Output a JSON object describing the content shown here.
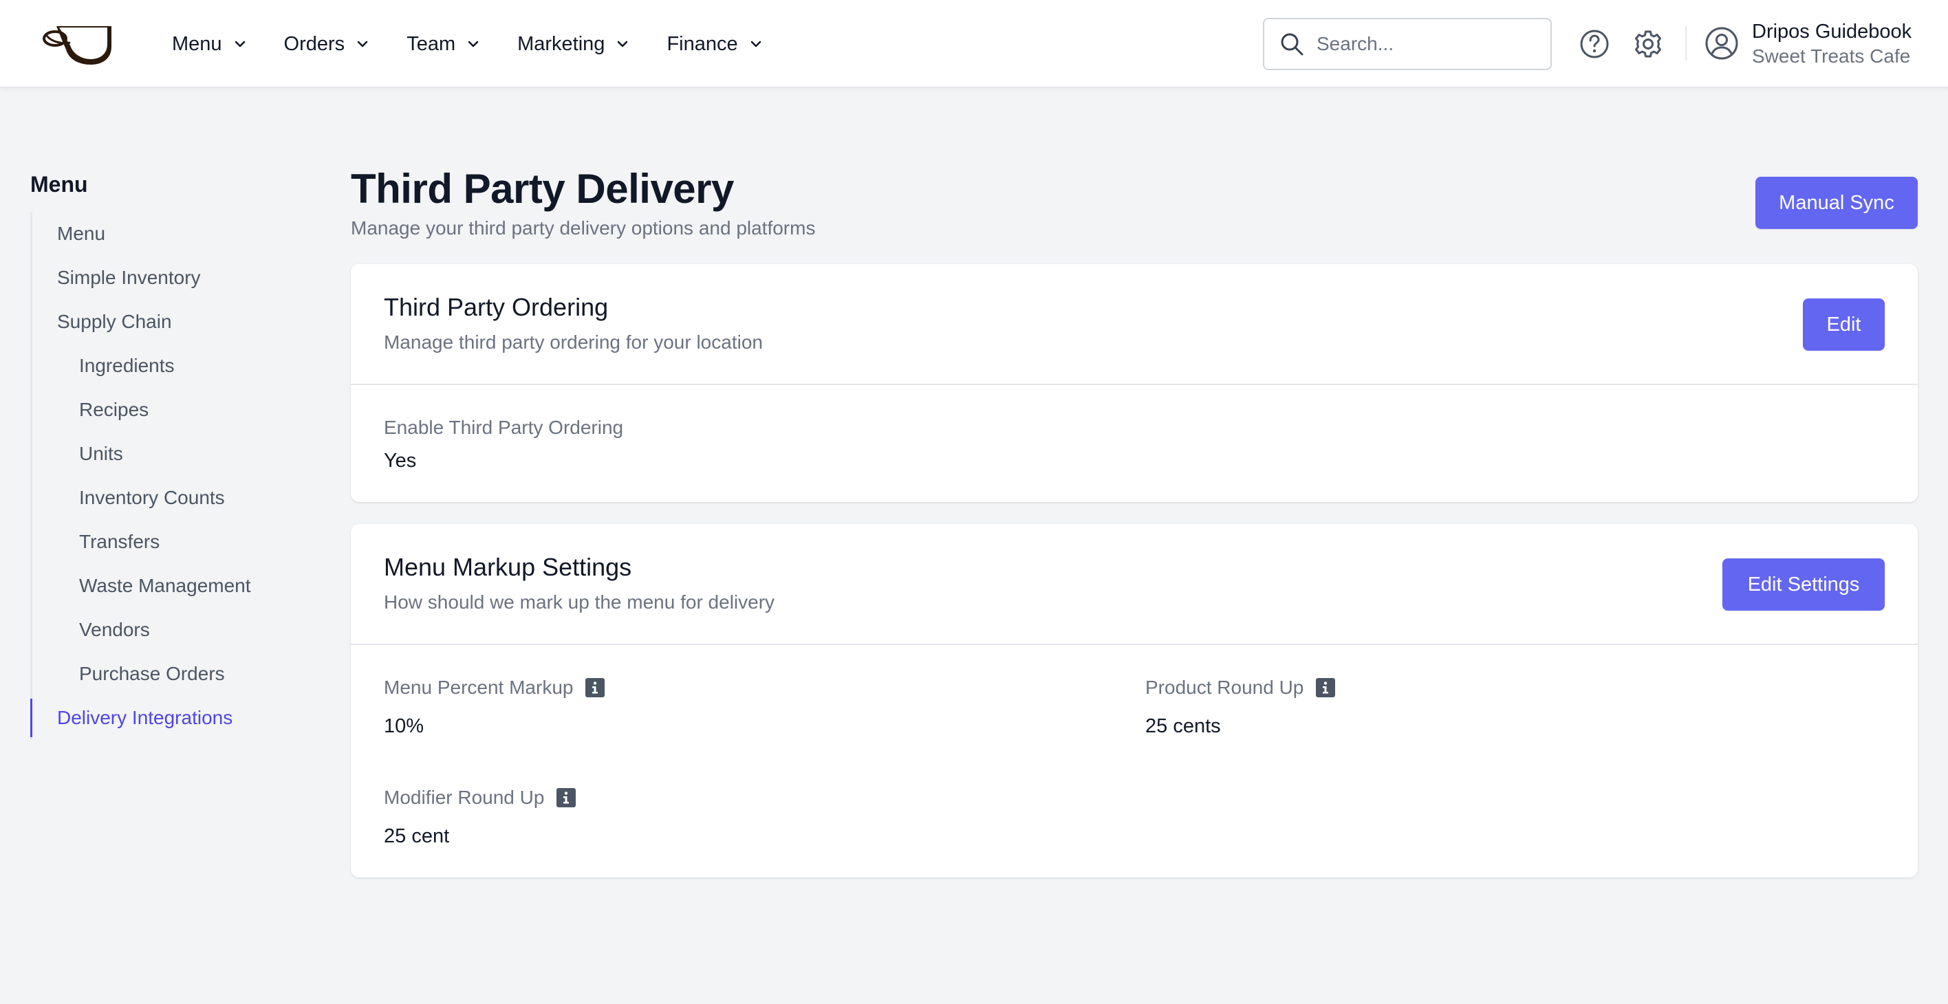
{
  "header": {
    "logo_icon": "coffee-cup-logo",
    "nav": [
      {
        "label": "Menu"
      },
      {
        "label": "Orders"
      },
      {
        "label": "Team"
      },
      {
        "label": "Marketing"
      },
      {
        "label": "Finance"
      }
    ],
    "search": {
      "placeholder": "Search..."
    },
    "icons": [
      "help-circle-icon",
      "gear-icon",
      "user-circle-icon"
    ],
    "user": {
      "name": "Dripos Guidebook",
      "location": "Sweet Treats Cafe"
    }
  },
  "sidebar": {
    "title": "Menu",
    "items": [
      {
        "label": "Menu",
        "level": 1
      },
      {
        "label": "Simple Inventory",
        "level": 1
      },
      {
        "label": "Supply Chain",
        "level": 1
      },
      {
        "label": "Ingredients",
        "level": 2
      },
      {
        "label": "Recipes",
        "level": 2
      },
      {
        "label": "Units",
        "level": 2
      },
      {
        "label": "Inventory Counts",
        "level": 2
      },
      {
        "label": "Transfers",
        "level": 2
      },
      {
        "label": "Waste Management",
        "level": 2
      },
      {
        "label": "Vendors",
        "level": 2
      },
      {
        "label": "Purchase Orders",
        "level": 2
      },
      {
        "label": "Delivery Integrations",
        "level": 1,
        "active": true
      }
    ]
  },
  "page": {
    "title": "Third Party Delivery",
    "subtitle": "Manage your third party delivery options and platforms",
    "manual_sync_label": "Manual Sync"
  },
  "ordering_card": {
    "title": "Third Party Ordering",
    "subtitle": "Manage third party ordering for your location",
    "edit_label": "Edit",
    "field_label": "Enable Third Party Ordering",
    "field_value": "Yes"
  },
  "markup_card": {
    "title": "Menu Markup Settings",
    "subtitle": "How should we mark up the menu for delivery",
    "edit_label": "Edit Settings",
    "fields": [
      {
        "label": "Menu Percent Markup",
        "value": "10%"
      },
      {
        "label": "Product Round Up",
        "value": "25 cents"
      },
      {
        "label": "Modifier Round Up",
        "value": "25 cent"
      }
    ]
  },
  "colors": {
    "accent": "#6366f1",
    "active_link": "#4f46e5",
    "background": "#f3f4f6",
    "muted_text": "#6b7280"
  }
}
